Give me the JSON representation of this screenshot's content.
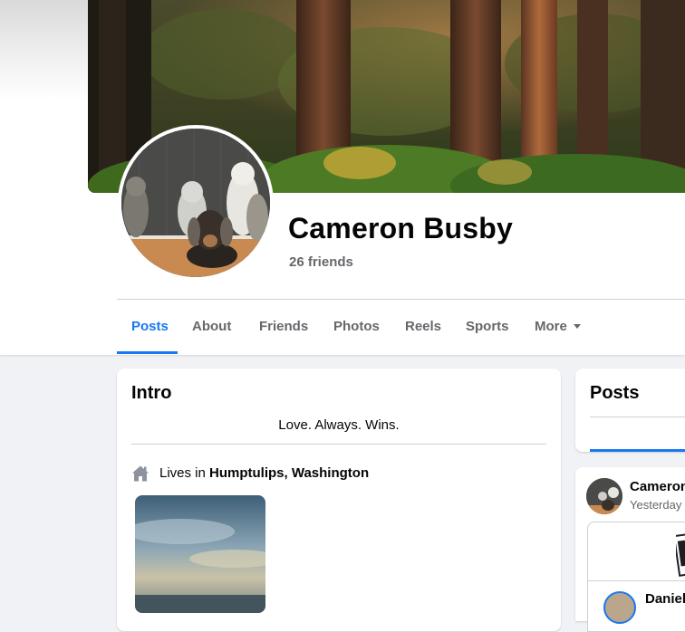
{
  "profile": {
    "name": "Cameron Busby",
    "friends": "26 friends"
  },
  "tabs": [
    {
      "label": "Posts",
      "active": true
    },
    {
      "label": "About"
    },
    {
      "label": "Friends"
    },
    {
      "label": "Photos"
    },
    {
      "label": "Reels"
    },
    {
      "label": "Sports"
    },
    {
      "label": "More",
      "icon": "caret-down-icon"
    }
  ],
  "intro": {
    "title": "Intro",
    "bio": "Love. Always. Wins.",
    "lives_prefix": "Lives in",
    "location": "Humptulips, Washington",
    "icon": "home-icon"
  },
  "posts_section": {
    "title": "Posts"
  },
  "post": {
    "author": "Cameron",
    "time": "Yesterday",
    "shared_author": "Daniel"
  },
  "colors": {
    "accent": "#1877f2",
    "background": "#f0f2f5",
    "secondary_text": "#65676b"
  }
}
